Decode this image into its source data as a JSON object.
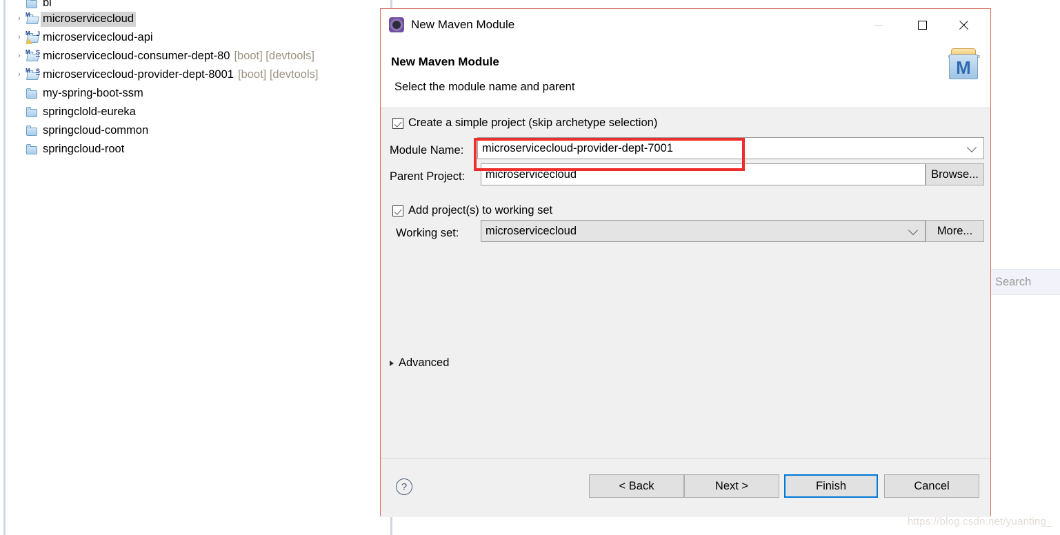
{
  "explorer": {
    "items": [
      {
        "label": "bi",
        "suffix": "",
        "icon": "folder-icon",
        "arrow": false,
        "selected": false,
        "clipped": true
      },
      {
        "label": "microservicecloud",
        "suffix": "",
        "icon": "maven-project-icon",
        "arrow": true,
        "selected": true,
        "clipped": false
      },
      {
        "label": "microservicecloud-api",
        "suffix": "",
        "icon": "maven-java-project-icon",
        "arrow": true,
        "selected": false,
        "clipped": false
      },
      {
        "label": "microservicecloud-consumer-dept-80",
        "suffix": "[boot] [devtools]",
        "icon": "maven-spring-project-icon",
        "arrow": true,
        "selected": false,
        "clipped": false
      },
      {
        "label": "microservicecloud-provider-dept-8001",
        "suffix": "[boot] [devtools]",
        "icon": "maven-spring-project-icon",
        "arrow": true,
        "selected": false,
        "clipped": false
      },
      {
        "label": "my-spring-boot-ssm",
        "suffix": "",
        "icon": "folder-icon",
        "arrow": false,
        "selected": false,
        "clipped": false
      },
      {
        "label": "springclold-eureka",
        "suffix": "",
        "icon": "folder-icon",
        "arrow": false,
        "selected": false,
        "clipped": false
      },
      {
        "label": "springcloud-common",
        "suffix": "",
        "icon": "folder-icon",
        "arrow": false,
        "selected": false,
        "clipped": false
      },
      {
        "label": "springcloud-root",
        "suffix": "",
        "icon": "folder-icon",
        "arrow": false,
        "selected": false,
        "clipped": false
      }
    ],
    "arrow_glyph": "›"
  },
  "search": {
    "placeholder": "Search"
  },
  "dialog": {
    "window_title": "New Maven Module",
    "header_title": "New Maven Module",
    "header_subtitle": "Select the module name and parent",
    "title_icon": "maven-gear-icon",
    "logo_icon": "maven-module-icon",
    "logo_letter": "M",
    "window_controls": {
      "minimize": "minimize-icon",
      "maximize": "maximize-icon",
      "close": "close-icon"
    },
    "form": {
      "simple_project_checkbox_label": "Create a simple project (skip archetype selection)",
      "simple_project_checked": true,
      "module_name_label": "Module Name:",
      "module_name_value": "microservicecloud-provider-dept-7001",
      "parent_project_label": "Parent Project:",
      "parent_project_value": "microservicecloud",
      "browse_button": "Browse...",
      "add_working_set_checkbox_label": "Add project(s) to working set",
      "add_working_set_checked": true,
      "working_set_label": "Working set:",
      "working_set_value": "microservicecloud",
      "more_button": "More...",
      "advanced_label": "Advanced",
      "advanced_expanded": false
    },
    "footer": {
      "help_glyph": "?",
      "back_button": "< Back",
      "next_button": "Next >",
      "finish_button": "Finish",
      "cancel_button": "Cancel",
      "default_button": "Finish"
    }
  },
  "annotation": {
    "color": "#ef2d2d",
    "target": "module-name-field"
  },
  "watermark": {
    "text": "https://blog.csdn.net/yuanting_"
  }
}
